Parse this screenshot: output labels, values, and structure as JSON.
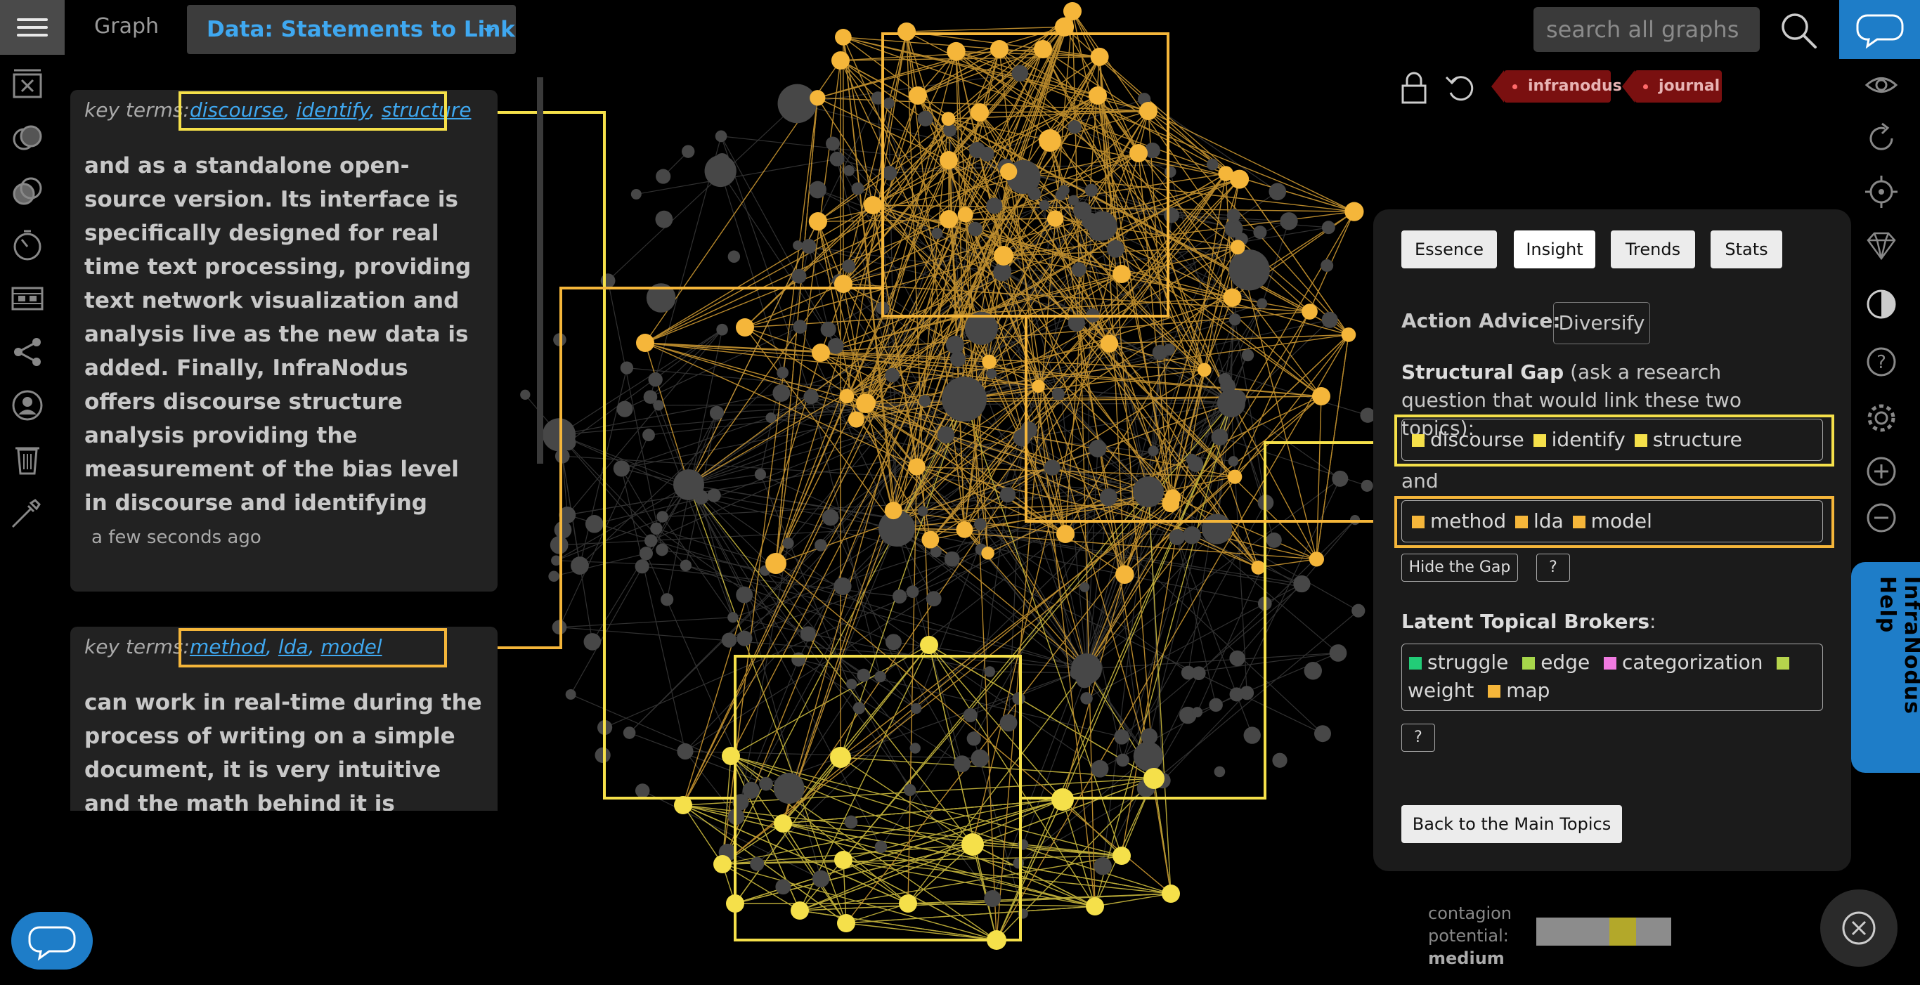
{
  "topbar": {
    "graph_label": "Graph",
    "data_select": "Data: Statements to Link",
    "search_placeholder": "search all graphs"
  },
  "statements": [
    {
      "key_terms_label": "key terms:",
      "terms": [
        "discourse",
        "identify",
        "structure"
      ],
      "text": "and as a standalone open-source version. Its interface is specifically designed for real time text processing, providing text network visualization and analysis live as the new data is added. Finally, InfraNodus offers discourse structure analysis providing the measurement of the bias level in discourse and identifying",
      "timestamp": "a few seconds ago"
    },
    {
      "key_terms_label": "key terms:",
      "terms": [
        "method",
        "lda",
        "model"
      ],
      "text": "can work in real-time during the process of writing on a simple document, it is very intuitive and the math behind it is relatively"
    }
  ],
  "tags": [
    "infranodus",
    "journal"
  ],
  "panel": {
    "tabs": [
      "Essence",
      "Insight",
      "Trends",
      "Stats"
    ],
    "action_advice_label": "Action Advice:",
    "action_advice_value": "Diversify",
    "gap_title": "Structural Gap",
    "gap_desc": " (ask a research question that would link these two topics):",
    "topic1": [
      "discourse",
      "identify",
      "structure"
    ],
    "and_label": "and",
    "topic2": [
      "method",
      "lda",
      "model"
    ],
    "hide_gap": "Hide the Gap",
    "help": "?",
    "brokers_label": "Latent Topical Brokers",
    "brokers_colon": ":",
    "brokers": [
      {
        "word": "struggle",
        "color": "#22cc77"
      },
      {
        "word": "edge",
        "color": "#a6d64a"
      },
      {
        "word": "categorization",
        "color": "#f07ae0"
      },
      {
        "word": "weight",
        "color": "#b6d44c"
      },
      {
        "word": "map",
        "color": "#f5b63a"
      }
    ],
    "back": "Back to the Main Topics"
  },
  "colors": {
    "topic1": "#f5e04a",
    "topic2": "#f5b63a",
    "accent": "#1e7dc8",
    "tag": "#7a1010"
  },
  "help_tab": "InfraNodus Help",
  "contagion": {
    "line1": "contagion",
    "line2": "potential:",
    "level": "medium",
    "fill": 0.2
  }
}
